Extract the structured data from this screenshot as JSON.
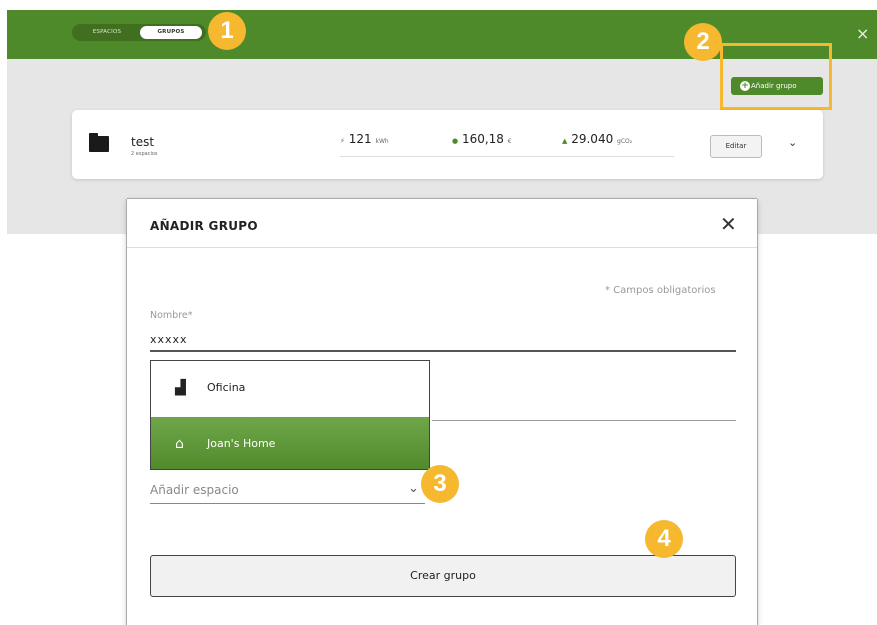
{
  "header": {
    "tabs": [
      "ESPACIOS",
      "GRUPOS"
    ],
    "active_tab": "GRUPOS",
    "close_symbol": "×",
    "brand_color": "#4f8a2a"
  },
  "annotations": {
    "step1": "1",
    "step2": "2",
    "step3": "3",
    "step4": "4",
    "badge_color": "#f5b82e"
  },
  "toolbar": {
    "add_group_label": "Añadir grupo",
    "add_group_icon": "plus-circle-icon"
  },
  "group_card": {
    "name": "test",
    "subtitle": "2 espacios",
    "energy_value": "121",
    "energy_unit": "kWh",
    "cost_value": "160,18",
    "cost_unit": "€",
    "co2_value": "29.040",
    "co2_unit": "gCO₂",
    "edit_label": "Editar",
    "folder_icon": "folder-icon",
    "expand_icon": "chevron-down-icon"
  },
  "modal": {
    "title": "AÑADIR GRUPO",
    "close_symbol": "✕",
    "required_note": "* Campos obligatorios",
    "name_label": "Nombre*",
    "name_value": "xxxxx",
    "dropdown_options": [
      {
        "label": "Oficina",
        "icon": "building-icon",
        "selected": false
      },
      {
        "label": "Joan's Home",
        "icon": "home-icon",
        "selected": true
      }
    ],
    "add_space_placeholder": "Añadir espacio",
    "create_label": "Crear grupo"
  }
}
